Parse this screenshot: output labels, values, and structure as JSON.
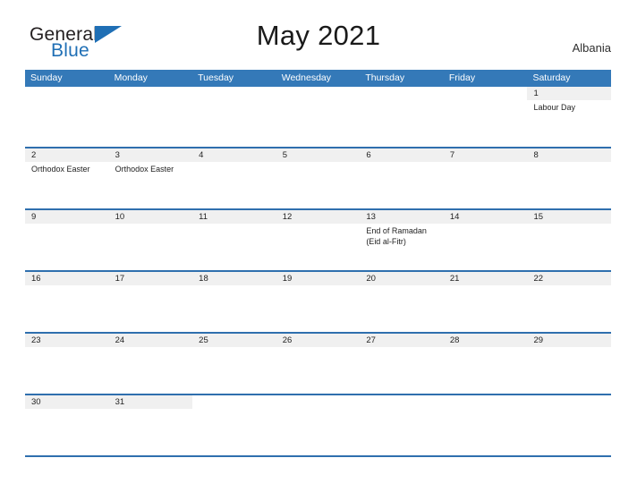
{
  "brand": {
    "name_part1": "General",
    "name_part2": "Blue",
    "triangle_color": "#1f6fb5"
  },
  "header": {
    "title": "May 2021",
    "region": "Albania"
  },
  "calendar": {
    "weekdays": [
      "Sunday",
      "Monday",
      "Tuesday",
      "Wednesday",
      "Thursday",
      "Friday",
      "Saturday"
    ],
    "header_bg": "#3479b8",
    "row_line_color": "#2f6fae",
    "daynum_band_bg": "#f0f0f0",
    "weeks": [
      [
        {
          "day": "",
          "events": []
        },
        {
          "day": "",
          "events": []
        },
        {
          "day": "",
          "events": []
        },
        {
          "day": "",
          "events": []
        },
        {
          "day": "",
          "events": []
        },
        {
          "day": "",
          "events": []
        },
        {
          "day": "1",
          "events": [
            "Labour Day"
          ]
        }
      ],
      [
        {
          "day": "2",
          "events": [
            "Orthodox Easter"
          ]
        },
        {
          "day": "3",
          "events": [
            "Orthodox Easter"
          ]
        },
        {
          "day": "4",
          "events": []
        },
        {
          "day": "5",
          "events": []
        },
        {
          "day": "6",
          "events": []
        },
        {
          "day": "7",
          "events": []
        },
        {
          "day": "8",
          "events": []
        }
      ],
      [
        {
          "day": "9",
          "events": []
        },
        {
          "day": "10",
          "events": []
        },
        {
          "day": "11",
          "events": []
        },
        {
          "day": "12",
          "events": []
        },
        {
          "day": "13",
          "events": [
            "End of Ramadan",
            "(Eid al-Fitr)"
          ]
        },
        {
          "day": "14",
          "events": []
        },
        {
          "day": "15",
          "events": []
        }
      ],
      [
        {
          "day": "16",
          "events": []
        },
        {
          "day": "17",
          "events": []
        },
        {
          "day": "18",
          "events": []
        },
        {
          "day": "19",
          "events": []
        },
        {
          "day": "20",
          "events": []
        },
        {
          "day": "21",
          "events": []
        },
        {
          "day": "22",
          "events": []
        }
      ],
      [
        {
          "day": "23",
          "events": []
        },
        {
          "day": "24",
          "events": []
        },
        {
          "day": "25",
          "events": []
        },
        {
          "day": "26",
          "events": []
        },
        {
          "day": "27",
          "events": []
        },
        {
          "day": "28",
          "events": []
        },
        {
          "day": "29",
          "events": []
        }
      ],
      [
        {
          "day": "30",
          "events": []
        },
        {
          "day": "31",
          "events": []
        },
        {
          "day": "",
          "events": []
        },
        {
          "day": "",
          "events": []
        },
        {
          "day": "",
          "events": []
        },
        {
          "day": "",
          "events": []
        },
        {
          "day": "",
          "events": []
        }
      ]
    ]
  }
}
